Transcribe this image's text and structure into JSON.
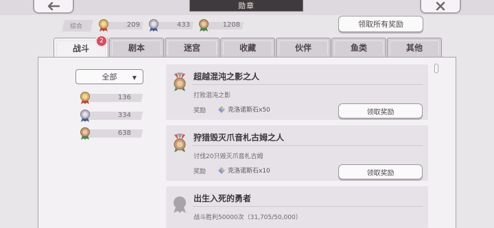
{
  "header": {
    "title": "勋章",
    "back_icon": "back-arrow-icon",
    "close_icon": "close-icon"
  },
  "summary": {
    "label": "综合",
    "counts": [
      {
        "icon": "gold-medal-icon",
        "value": "209"
      },
      {
        "icon": "silver-medal-icon",
        "value": "433"
      },
      {
        "icon": "bronze-medal-icon",
        "value": "1208"
      }
    ],
    "claim_all_label": "领取所有奖励"
  },
  "tabs": [
    {
      "label": "战斗",
      "active": true,
      "badge": "2"
    },
    {
      "label": "剧本"
    },
    {
      "label": "迷宫"
    },
    {
      "label": "收藏"
    },
    {
      "label": "伙伴"
    },
    {
      "label": "鱼类"
    },
    {
      "label": "其他"
    }
  ],
  "sidebar": {
    "filter_value": "全部",
    "stats": [
      {
        "icon": "gold-medal-icon",
        "value": "136"
      },
      {
        "icon": "silver-medal-icon",
        "value": "334"
      },
      {
        "icon": "bronze-medal-icon",
        "value": "638"
      }
    ]
  },
  "achievements": [
    {
      "title": "超越混沌之影之人",
      "description": "打败混沌之影",
      "reward_label": "奖励",
      "reward": "克洛诺斯石x50",
      "button_label": "领取奖励",
      "medal": "bronze-medal-icon"
    },
    {
      "title": "狩猎毁灭爪音札古姆之人",
      "description": "讨伐20只毁灭爪音札古姆",
      "reward_label": "奖励",
      "reward": "克洛诺斯石x10",
      "button_label": "领取奖励",
      "medal": "bronze-medal-icon"
    },
    {
      "title": "出生入死的勇者",
      "description": "战斗胜利50000次（31,705/50,000）",
      "medal": "locked-medal-icon"
    }
  ],
  "colors": {
    "background": "#e9e6ea",
    "panel": "#f3f1f4",
    "card": "#e6e2e7",
    "badge": "#d05060",
    "title_plate": "#3e3a3e"
  }
}
